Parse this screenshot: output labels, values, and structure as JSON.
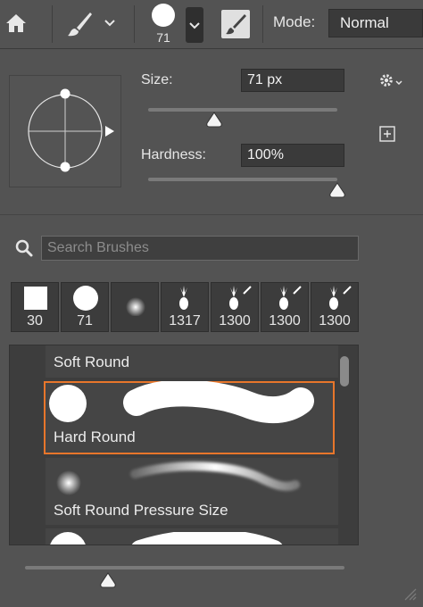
{
  "toolbar": {
    "brush_size": "71",
    "mode_label": "Mode:",
    "mode_value": "Normal"
  },
  "brush_settings": {
    "size_label": "Size:",
    "size_value": "71 px",
    "size_fraction": 0.35,
    "hardness_label": "Hardness:",
    "hardness_value": "100%",
    "hardness_fraction": 1.0
  },
  "search": {
    "placeholder": "Search Brushes"
  },
  "presets": [
    {
      "label": "30",
      "icon": "square-brush-icon"
    },
    {
      "label": "71",
      "icon": "hard-round-brush-icon"
    },
    {
      "label": "",
      "icon": "soft-round-brush-icon"
    },
    {
      "label": "1317",
      "icon": "pineapple-brush-icon"
    },
    {
      "label": "1300",
      "icon": "pineapple-brush-icon"
    },
    {
      "label": "1300",
      "icon": "pineapple-brush-icon"
    },
    {
      "label": "1300",
      "icon": "pineapple-brush-icon"
    }
  ],
  "brush_list": [
    {
      "label": "Soft Round"
    },
    {
      "label": "Hard Round",
      "selected": true
    },
    {
      "label": "Soft Round Pressure Size"
    }
  ],
  "colors": {
    "selection": "#e8762b",
    "panel_bg": "#535353"
  },
  "preview_size_fraction": 0.26
}
